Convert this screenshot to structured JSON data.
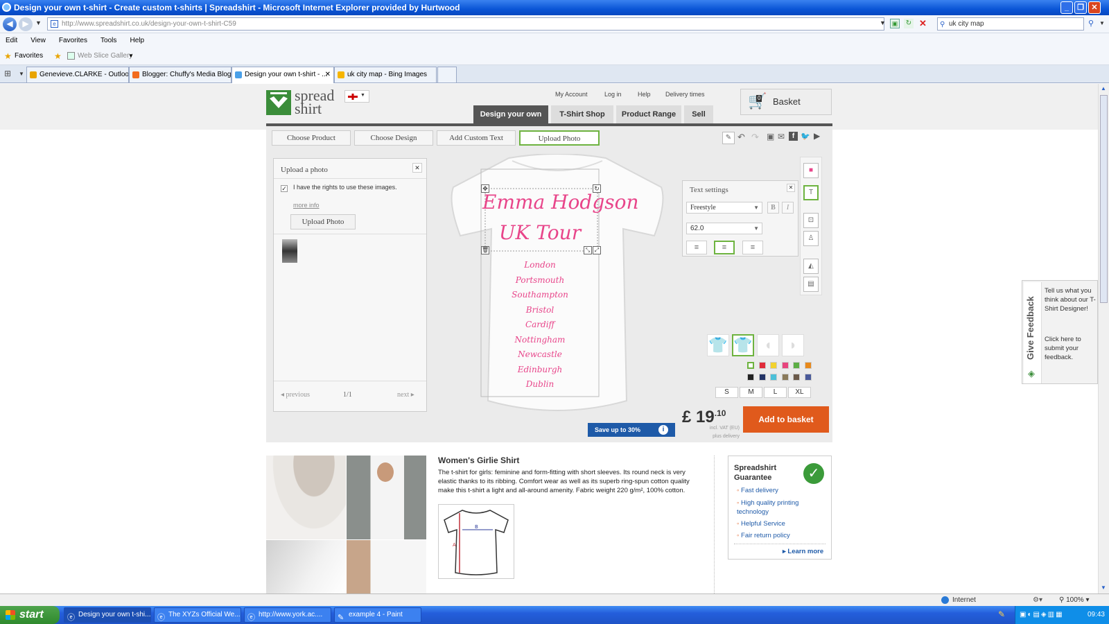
{
  "window": {
    "title": "Design your own t-shirt - Create custom t-shirts | Spreadshirt - Microsoft Internet Explorer provided by Hurtwood"
  },
  "address_bar": {
    "url": "http://www.spreadshirt.co.uk/design-your-own-t-shirt-C59",
    "search_value": "uk city map"
  },
  "menu": [
    "Edit",
    "View",
    "Favorites",
    "Tools",
    "Help"
  ],
  "favorites": {
    "label": "Favorites",
    "web_slice": "Web Slice Gallery"
  },
  "tabs": [
    {
      "label": "Genevieve.CLARKE - Outlook..."
    },
    {
      "label": "Blogger: Chuffy's Media Blog ..."
    },
    {
      "label": "Design your own t-shirt - ..."
    },
    {
      "label": "uk city map - Bing Images"
    }
  ],
  "site": {
    "logo_line1": "spread",
    "logo_line2": "shirt",
    "top_links": [
      "My Account",
      "Log in",
      "Help",
      "Delivery times"
    ],
    "basket": "Basket",
    "basket_count": "0",
    "main_nav": [
      "Design your own",
      "T-Shirt Shop",
      "Product Range",
      "Sell"
    ]
  },
  "designer": {
    "tabs": [
      "Choose Product",
      "Choose Design",
      "Add Custom Text",
      "Upload Photo"
    ],
    "upload": {
      "title": "Upload a photo",
      "rights_text": "I have the rights to use these images.",
      "more_info": "more info",
      "button": "Upload Photo",
      "prev": "previous",
      "page": "1/1",
      "next": "next"
    },
    "shirt_text": {
      "line1": "Emma Hodgson",
      "line2": "UK Tour",
      "cities": [
        "London",
        "Portsmouth",
        "Southampton",
        "Bristol",
        "Cardiff",
        "Nottingham",
        "Newcastle",
        "Edinburgh",
        "Dublin"
      ]
    },
    "text_settings": {
      "title": "Text settings",
      "font": "Freestyle",
      "size": "62.0",
      "bold": "B",
      "italic": "I"
    },
    "sizes": [
      "S",
      "M",
      "L",
      "XL"
    ],
    "colors": [
      "#ffffff",
      "#e02b3a",
      "#f2d22e",
      "#e8457e",
      "#5cae45",
      "#e8891c",
      "#222222",
      "#223366",
      "#4cc0d8",
      "#8a7a5a",
      "#6b5a4a",
      "#4a5a9a"
    ],
    "price": {
      "currency": "£",
      "main": "19",
      "cents": "10",
      "vat": "incl. VAT (EU)",
      "delivery": "plus delivery"
    },
    "add_to_basket": "Add to basket",
    "save_banner": "Save up to 30%"
  },
  "product": {
    "title": "Women's Girlie Shirt",
    "description": "The t-shirt for girls: feminine and form-fitting with short sleeves. Its round neck is very elastic thanks to its ribbing. Comfort wear as well as its superb ring-spun cotton quality make this t-shirt a light and all-around amenity. Fabric weight 220 g/m², 100% cotton."
  },
  "guarantee": {
    "title": "Spreadshirt Guarantee",
    "items": [
      "Fast delivery",
      "High quality printing technology",
      "Helpful Service",
      "Fair return policy"
    ],
    "learn_more": "Learn more"
  },
  "feedback": {
    "tab": "Give Feedback",
    "text1": "Tell us what you think about our T-Shirt Designer!",
    "text2": "Click here to submit your feedback."
  },
  "status_bar": {
    "zone": "Internet",
    "zoom": "100%"
  },
  "taskbar": {
    "start": "start",
    "tasks": [
      "Design your own t-shi...",
      "The XYZs Official We...",
      "http://www.york.ac....",
      "example 4 - Paint"
    ],
    "clock": "09:43"
  }
}
